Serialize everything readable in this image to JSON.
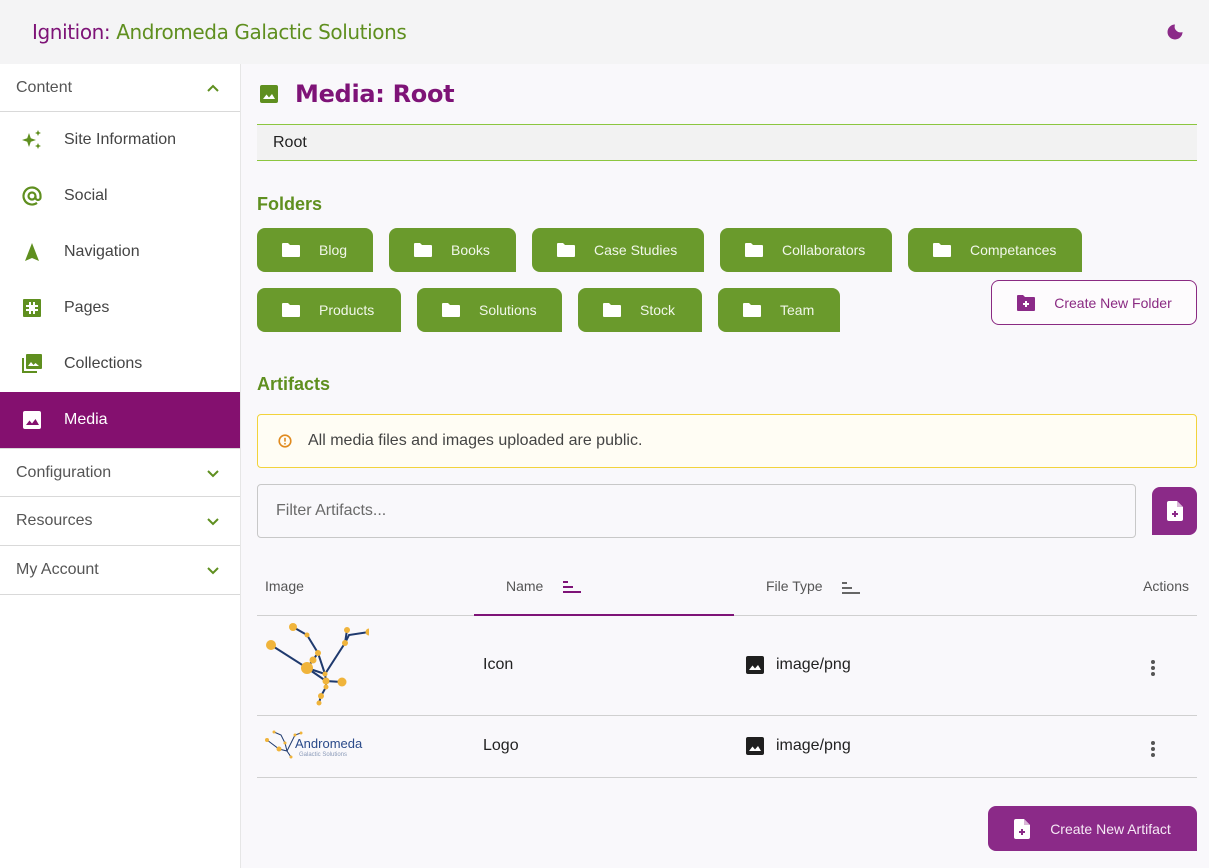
{
  "header": {
    "title_prefix": "Ignition: ",
    "title_name": "Andromeda Galactic Solutions",
    "theme_toggle_icon": "moon-icon"
  },
  "sidebar": {
    "sections": [
      {
        "label": "Content",
        "expanded": true,
        "chevron": "chevron-up-icon"
      },
      {
        "label": "Configuration",
        "expanded": false,
        "chevron": "chevron-down-icon"
      },
      {
        "label": "Resources",
        "expanded": false,
        "chevron": "chevron-down-icon"
      },
      {
        "label": "My Account",
        "expanded": false,
        "chevron": "chevron-down-icon"
      }
    ],
    "content_items": [
      {
        "label": "Site Information",
        "icon": "sparkles-icon",
        "active": false
      },
      {
        "label": "Social",
        "icon": "at-sign-icon",
        "active": false
      },
      {
        "label": "Navigation",
        "icon": "navigation-arrow-icon",
        "active": false
      },
      {
        "label": "Pages",
        "icon": "pages-icon",
        "active": false
      },
      {
        "label": "Collections",
        "icon": "photo-library-icon",
        "active": false
      },
      {
        "label": "Media",
        "icon": "image-icon",
        "active": true
      }
    ]
  },
  "main": {
    "title": "Media: Root",
    "breadcrumb": [
      "Root"
    ],
    "folders_heading": "Folders",
    "folders": [
      "Blog",
      "Books",
      "Case Studies",
      "Collaborators",
      "Competances",
      "Products",
      "Solutions",
      "Stock",
      "Team"
    ],
    "create_folder_label": "Create New Folder",
    "artifacts_heading": "Artifacts",
    "notice": "All media files and images uploaded are public.",
    "filter_placeholder": "Filter Artifacts...",
    "filter_value": "",
    "table": {
      "columns": [
        "Image",
        "Name",
        "File Type",
        "Actions"
      ],
      "sorted_column": "Name",
      "rows": [
        {
          "image": "Andromeda constellation icon",
          "name": "Icon",
          "file_type": "image/png"
        },
        {
          "image": "Andromeda Galactic Solutions logo",
          "name": "Logo",
          "file_type": "image/png"
        }
      ]
    },
    "logo_text_main": "Andromeda",
    "logo_text_sub": "Galactic Solutions",
    "create_artifact_label": "Create New Artifact"
  },
  "colors": {
    "brand_purple": "#7e1377",
    "brand_green": "#5f8f1f",
    "folder_green": "#6a9a2c",
    "button_purple": "#8b2a88",
    "breadcrumb_line": "#8cc63f",
    "notice_border": "#f2d33b"
  }
}
